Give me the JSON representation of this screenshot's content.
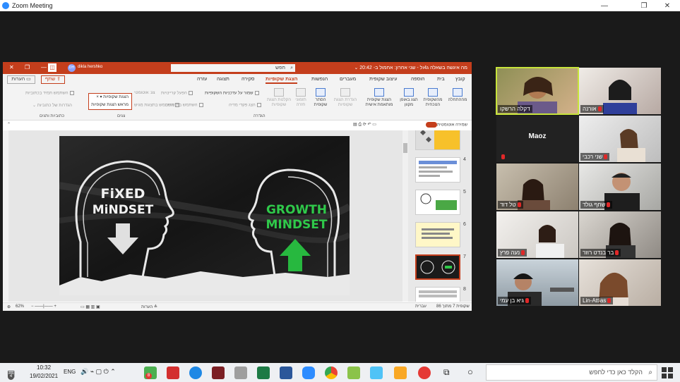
{
  "zoom": {
    "title": "Zoom Meeting",
    "minimize": "—",
    "restore": "❐",
    "close": "✕"
  },
  "ppt": {
    "doc_title": "מה איגשה בשאלה ג4ול - שני אחרון: אחמול ב- 20:42 ⌄",
    "search_placeholder": "חפש",
    "user_name": "dikla hershko",
    "user_initials": "DH",
    "tabs": [
      "קובץ",
      "בית",
      "הוספה",
      "עיצוב שקופית",
      "מעברים",
      "הנפשות",
      "הצגת שקופיות",
      "סקירה",
      "תצוגה",
      "עזרה"
    ],
    "active_tab": "הצגת שקופיות",
    "share_label": "שתף",
    "comments_label": "הערות",
    "ribbon": {
      "items": [
        "מההתחלה",
        "מהשקופית הנוכחית",
        "הצג באופן מקוון",
        "הצגת שקופית מותאמת אישית",
        "הגדרת הצגת שקופיות",
        "הסתר שקופית",
        "תזמוני חזרה",
        "הקלטת הצגת שקופיות"
      ],
      "group_start": "התחלת הצגת שקופיות",
      "group_setup": "הגדרה",
      "group_monitors": "צגים",
      "group_captions": "כתוביות ותגים",
      "check_play_narrations": "הפעל קריינויות",
      "check_use_timings": "השתמש בתזמונים",
      "check_show_media": "הצג פקדי מדיה",
      "check_keep_updated": "שמור על עדכניות השקופיות",
      "check_presenter_view": "השתמש בתצוגת מגיש",
      "check_subtitles": "השתמש תמיד בכתוביות",
      "check_caption_settings": "הגדרות של כתוביות",
      "monitor_label": "צג:",
      "monitor_value": "אוטומטי",
      "dropdown_options": [
        "הצגת שקופיות",
        "מראש הצגת שקופיות"
      ]
    },
    "autosave_label": "שמירה אוטומטית",
    "thumb_numbers": [
      "4",
      "5",
      "6",
      "7",
      "8"
    ],
    "slide": {
      "left_line1": "FiXED",
      "left_line2": "MiNDSET",
      "right_line1": "GROWTH",
      "right_line2": "MINDSET"
    },
    "status": {
      "slide_count": "שקופית 7 מתוך 86",
      "language": "עברית",
      "notes": "הערות",
      "zoom": "62%"
    }
  },
  "gallery": [
    {
      "name": "דקלה הרשקו",
      "mic": false,
      "active": true
    },
    {
      "name": "אורנה",
      "mic": true,
      "active": false
    },
    {
      "name": "Maoz",
      "mic": true,
      "active": false,
      "video": false
    },
    {
      "name": "שני רכבי",
      "mic": true,
      "active": false
    },
    {
      "name": "טל דוד",
      "mic": true,
      "active": false
    },
    {
      "name": "שחף גולד",
      "mic": true,
      "active": false
    },
    {
      "name": "נעה פרץ",
      "mic": true,
      "active": false
    },
    {
      "name": "בר בנדט רוזר",
      "mic": true,
      "active": false
    },
    {
      "name": "גיא בן עמי",
      "mic": true,
      "active": false
    },
    {
      "name": "Lin-Attias",
      "mic": true,
      "active": false
    }
  ],
  "taskbar": {
    "search_placeholder": "הקלד כאן כדי לחפש",
    "time": "10:32",
    "date": "19/02/2021",
    "lang": "ENG",
    "notif_count": "4",
    "chrome_badge": "8"
  }
}
